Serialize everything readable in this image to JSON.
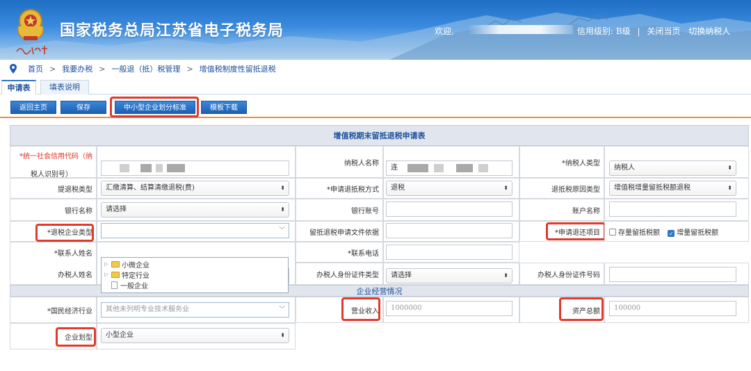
{
  "header": {
    "site_title": "国家税务总局江苏省电子税务局",
    "welcome": "欢迎,",
    "credit_level": "信用级别: B级",
    "close_page": "关闭当页",
    "switch_taxpayer": "切换纳税人",
    "separator": "|",
    "emblem_signature": "中国税务"
  },
  "breadcrumb": [
    "首页",
    "我要办税",
    "一般退（抵）税管理",
    "增值税制度性留抵退税"
  ],
  "breadcrumb_sep": ">",
  "tabs": [
    "申请表",
    "填表说明"
  ],
  "toolbar": {
    "home": "返回主页",
    "save": "保存",
    "sme_standard": "中小型企业划分标准",
    "template_download": "模板下载"
  },
  "form": {
    "title": "增值税期末留抵退税申请表",
    "credit_code_label_1": "*统一社会信用代码（纳",
    "credit_code_label_2": "税人识别号）",
    "taxpayer_name_label": "纳税人名称",
    "taxpayer_name_prefix": "连",
    "taxpayer_type_label": "*纳税人类型",
    "taxpayer_type_value": "纳税人",
    "refund_type_label": "提退税类型",
    "refund_type_value": "汇缴清算、结算清缴退税(费)",
    "refund_method_label": "*申请退抵税方式",
    "refund_method_value": "退税",
    "refund_reason_label": "退抵税原因类型",
    "refund_reason_value": "增值税增量留抵税额退税",
    "bank_name_label": "银行名称",
    "bank_name_value": "请选择",
    "bank_account_label": "银行账号",
    "account_name_label": "账户名称",
    "enterprise_type_label": "*退税企业类型",
    "doc_basis_label": "留抵退税申请文件依据",
    "apply_item_label": "*申请退还项目",
    "stock_credit": "存量留抵税额",
    "increment_credit": "增量留抵税额",
    "contact_name_label": "*联系人姓名",
    "contact_phone_label": "*联系电话",
    "handler_name_label": "办税人姓名",
    "handler_id_type_label": "办税人身份证件类型",
    "handler_id_type_value": "请选择",
    "handler_id_no_label": "办税人身份证件号码",
    "section_operation": "企业经营情况",
    "industry_label": "*国民经济行业",
    "industry_value": "其他未列明专业技术服务业",
    "revenue_label": "营业收入",
    "revenue_value": "1000000",
    "assets_label": "资产总额",
    "assets_value": "100000",
    "size_label": "企业划型",
    "size_value": "小型企业"
  },
  "enterprise_type_tree": [
    "小微企业",
    "特定行业",
    "一般企业"
  ],
  "colors": {
    "accent_blue": "#1c4f9c",
    "button_blue": "#2f74c9",
    "highlight_red": "#e03a2e",
    "divider_orange": "#f08a3c"
  }
}
